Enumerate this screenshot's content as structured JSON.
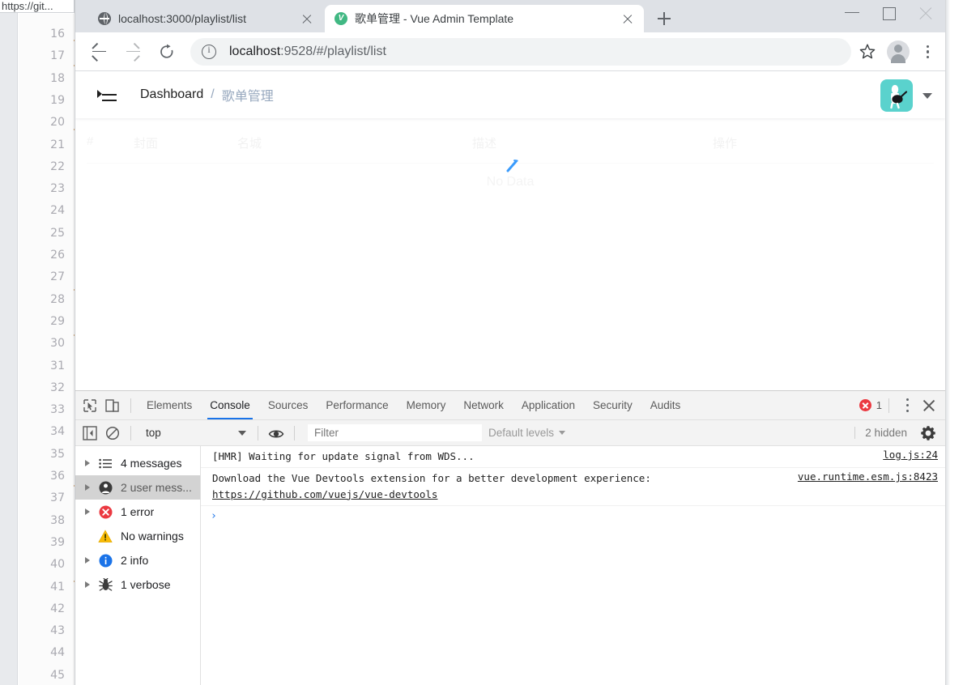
{
  "background_editor": {
    "url_chip": "https://git...",
    "line_numbers": [
      "16",
      "17",
      "18",
      "19",
      "20",
      "21",
      "22",
      "23",
      "24",
      "25",
      "26",
      "27",
      "28",
      "29",
      "30",
      "31",
      "32",
      "33",
      "34",
      "35",
      "36",
      "37",
      "38",
      "39",
      "40",
      "41",
      "42",
      "43",
      "44",
      "45"
    ]
  },
  "browser": {
    "tabs": [
      {
        "title": "localhost:3000/playlist/list",
        "favicon": "globe-icon",
        "active": false
      },
      {
        "title": "歌单管理 - Vue Admin Template",
        "favicon": "vue-icon",
        "active": true
      }
    ],
    "new_tab_label": "+",
    "window_controls": {
      "minimize": "minimize-icon",
      "maximize": "maximize-icon",
      "close": "close-icon"
    },
    "toolbar": {
      "back": "back-arrow-icon",
      "forward": "forward-arrow-icon",
      "reload": "reload-icon",
      "url_host": "localhost",
      "url_rest": ":9528/#/playlist/list",
      "bookmark": "star-icon",
      "profile": "profile-avatar-icon",
      "menu": "kebab-menu-icon"
    }
  },
  "app": {
    "navbar": {
      "hamburger": "hamburger-icon",
      "breadcrumb": [
        {
          "label": "Dashboard",
          "active": false
        },
        {
          "label": "歌单管理",
          "active": true
        }
      ],
      "breadcrumb_separator": "/",
      "avatar": "user-avatar",
      "avatar_caret": "chevron-down-icon"
    },
    "table": {
      "columns": [
        "#",
        "封面",
        "名城",
        "描述",
        "操作"
      ],
      "empty_text": "No Data",
      "loading": true,
      "spinner_color": "#409eff"
    }
  },
  "devtools": {
    "tabs": [
      "Elements",
      "Console",
      "Sources",
      "Performance",
      "Memory",
      "Network",
      "Application",
      "Security",
      "Audits"
    ],
    "active_tab": "Console",
    "inspect_icon": "inspect-cursor-icon",
    "device_icon": "device-toolbar-icon",
    "error_count": "1",
    "more_icon": "kebab-menu-icon",
    "close_icon": "close-icon",
    "filterbar": {
      "sidebar_toggle": "sidebar-toggle-icon",
      "clear_console": "clear-console-icon",
      "context": "top",
      "eye_icon": "live-expression-icon",
      "filter_placeholder": "Filter",
      "levels": "Default levels",
      "hidden_count": "2 hidden",
      "settings_icon": "gear-icon"
    },
    "sidebar": [
      {
        "label": "4 messages",
        "icon": "list-icon",
        "expandable": true,
        "selected": false
      },
      {
        "label": "2 user mess...",
        "icon": "user-icon",
        "expandable": true,
        "selected": true
      },
      {
        "label": "1 error",
        "icon": "error-icon",
        "expandable": true,
        "selected": false
      },
      {
        "label": "No warnings",
        "icon": "warning-icon",
        "expandable": false,
        "selected": false
      },
      {
        "label": "2 info",
        "icon": "info-icon",
        "expandable": true,
        "selected": false
      },
      {
        "label": "1 verbose",
        "icon": "verbose-bug-icon",
        "expandable": true,
        "selected": false
      }
    ],
    "messages": [
      {
        "text": "[HMR] Waiting for update signal from WDS...",
        "link": "",
        "source": "log.js:24"
      },
      {
        "text": "Download the Vue Devtools extension for a better development experience:",
        "link": "https://github.com/vuejs/vue-devtools",
        "source": "vue.runtime.esm.js:8423"
      }
    ],
    "prompt": "›"
  }
}
